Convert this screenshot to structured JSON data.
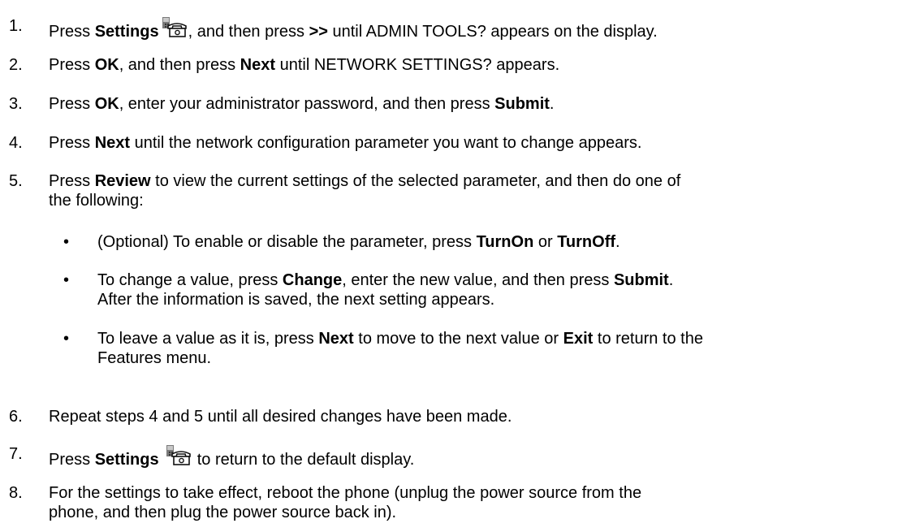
{
  "steps": [
    {
      "num": "1.",
      "parts": [
        {
          "t": "Press "
        },
        {
          "b": "Settings"
        },
        {
          "icon": "settings-phone-icon"
        },
        {
          "t": ", and then press "
        },
        {
          "b": ">>"
        },
        {
          "t": " until ADMIN TOOLS? appears on the display."
        }
      ]
    },
    {
      "num": "2.",
      "parts": [
        {
          "t": "Press "
        },
        {
          "b": "OK"
        },
        {
          "t": ", and then press "
        },
        {
          "b": "Next"
        },
        {
          "t": " until NETWORK SETTINGS? appears."
        }
      ]
    },
    {
      "num": "3.",
      "parts": [
        {
          "t": "Press "
        },
        {
          "b": "OK"
        },
        {
          "t": ", enter your administrator password, and then press "
        },
        {
          "b": "Submit"
        },
        {
          "t": "."
        }
      ]
    },
    {
      "num": "4.",
      "parts": [
        {
          "t": "Press "
        },
        {
          "b": "Next"
        },
        {
          "t": " until the network configuration parameter you want to change appears."
        }
      ]
    },
    {
      "num": "5.",
      "parts": [
        {
          "t": "Press "
        },
        {
          "b": "Review"
        },
        {
          "t": " to view the current settings of the selected parameter, and then do one of"
        },
        {
          "br": true
        },
        {
          "t": "the following:"
        }
      ],
      "bullets": [
        [
          {
            "t": "(Optional) To enable or disable the parameter, press "
          },
          {
            "b": "TurnOn"
          },
          {
            "t": " or "
          },
          {
            "b": "TurnOff"
          },
          {
            "t": "."
          }
        ],
        [
          {
            "t": "To change a value, press "
          },
          {
            "b": "Change"
          },
          {
            "t": ", enter the new value, and then press "
          },
          {
            "b": "Submit"
          },
          {
            "t": "."
          },
          {
            "br": true
          },
          {
            "t": "After the information is saved, the next setting appears."
          }
        ],
        [
          {
            "t": "To leave a value as it is, press "
          },
          {
            "b": "Next"
          },
          {
            "t": " to move to the next value or "
          },
          {
            "b": "Exit"
          },
          {
            "t": " to return to the"
          },
          {
            "br": true
          },
          {
            "t": "Features menu."
          }
        ]
      ]
    },
    {
      "num": "6.",
      "parts": [
        {
          "t": "Repeat steps 4 and 5 until all desired changes have been made."
        }
      ]
    },
    {
      "num": "7.",
      "parts": [
        {
          "t": "Press "
        },
        {
          "b": "Settings"
        },
        {
          "t": " "
        },
        {
          "icon": "settings-phone-icon"
        },
        {
          "t": " to return to the default display."
        }
      ]
    },
    {
      "num": "8.",
      "parts": [
        {
          "t": "For the settings to take effect, reboot the phone (unplug the power source from the"
        },
        {
          "br": true
        },
        {
          "t": "phone, and then plug the power source back in)."
        }
      ]
    }
  ],
  "bullet_char": "•"
}
